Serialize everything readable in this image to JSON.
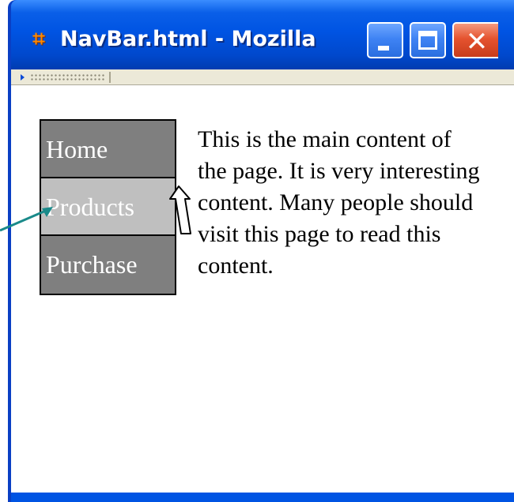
{
  "window": {
    "title": "NavBar.html - Mozilla",
    "app_icon": "mozilla-icon",
    "controls": [
      {
        "name": "minimize",
        "icon": "minimize-icon"
      },
      {
        "name": "maximize",
        "icon": "maximize-icon"
      },
      {
        "name": "close",
        "icon": "close-icon",
        "glyph": "✕"
      }
    ]
  },
  "toolbar": {
    "grip_icon": "toolbar-grip-icon"
  },
  "nav": {
    "items": [
      {
        "label": "Home",
        "state": "normal"
      },
      {
        "label": "Products",
        "state": "hover"
      },
      {
        "label": "Purchase",
        "state": "normal"
      }
    ]
  },
  "content": {
    "text": "This is the main content of the page. It is very interesting content. Many people should visit this page to read this content."
  },
  "annotations": {
    "callout_arrow": "teal-callout-arrow",
    "mouse_cursor": "mouse-pointer-icon"
  },
  "colors": {
    "titlebar": "#0054e3",
    "nav_normal": "#7f7f7f",
    "nav_hover": "#bfbfbf",
    "nav_text": "#ffffff",
    "close_button": "#e5532f",
    "callout": "#1a8a8a"
  }
}
